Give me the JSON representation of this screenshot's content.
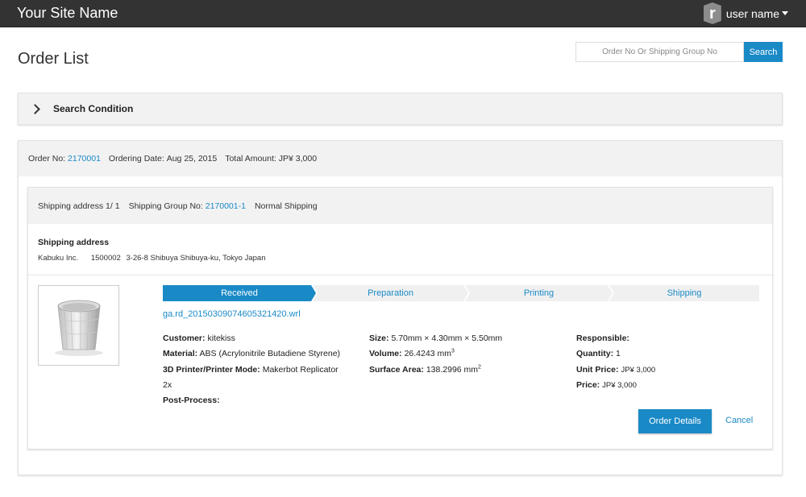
{
  "header": {
    "site_name": "Your Site Name",
    "user_logo_letter": "r",
    "user_name": "user name"
  },
  "page": {
    "title": "Order List"
  },
  "search": {
    "placeholder": "Order No Or Shipping Group No",
    "button_label": "Search"
  },
  "search_condition": {
    "label": "Search Condition"
  },
  "order": {
    "order_no_label": "Order No:",
    "order_no": "2170001",
    "ordering_date_label": "Ordering Date:",
    "ordering_date": "Aug 25, 2015",
    "total_amount_label": "Total Amount:",
    "total_amount": "JP¥ 3,000",
    "shipping": {
      "address_counter": "Shipping address 1/ 1",
      "group_no_label": "Shipping Group No:",
      "group_no": "2170001-1",
      "method": "Normal Shipping",
      "address_title": "Shipping address",
      "recipient": "Kabuku Inc.",
      "postal_code": "1500002",
      "address": "3-26-8 Shibuya Shibuya-ku, Tokyo Japan"
    },
    "item": {
      "steps": [
        "Received",
        "Preparation",
        "Printing",
        "Shipping"
      ],
      "active_step": "Received",
      "file_name": "ga.rd_20150309074605321420.wrl",
      "customer_label": "Customer:",
      "customer": "kitekiss",
      "material_label": "Material:",
      "material": "ABS (Acrylonitrile Butadiene Styrene)",
      "printer_label": "3D Printer/Printer Mode:",
      "printer_line1": "Makerbot Replicator",
      "printer_line2": "2x",
      "post_process_label": "Post-Process:",
      "size_label": "Size:",
      "size": "5.70mm × 4.30mm × 5.50mm",
      "volume_label": "Volume:",
      "volume": "26.4243 mm",
      "volume_exp": "3",
      "surface_label": "Surface Area:",
      "surface": "138.2996 mm",
      "surface_exp": "2",
      "responsible_label": "Responsible:",
      "quantity_label": "Quantity:",
      "quantity": "1",
      "unit_price_label": "Unit Price:",
      "unit_price": "JP¥ 3,000",
      "price_label": "Price:",
      "price": "JP¥ 3,000",
      "details_button": "Order Details",
      "cancel_link": "Cancel"
    }
  },
  "colors": {
    "topbar": "#333333",
    "accent": "#1a8ac7",
    "panel_bg": "#f2f2f2"
  }
}
